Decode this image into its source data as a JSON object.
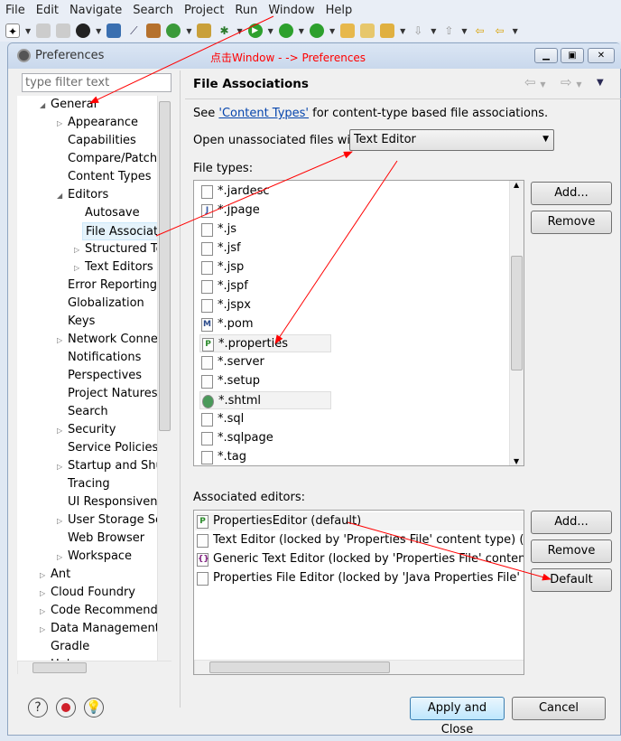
{
  "menubar": [
    "File",
    "Edit",
    "Navigate",
    "Search",
    "Project",
    "Run",
    "Window",
    "Help"
  ],
  "annotation": "点击Window - -> Preferences",
  "dialog": {
    "title": "Preferences",
    "filter_placeholder": "type filter text"
  },
  "tree": [
    {
      "label": "General",
      "level": 0,
      "expanded": true
    },
    {
      "label": "Appearance",
      "level": 1,
      "children": true
    },
    {
      "label": "Capabilities",
      "level": 1
    },
    {
      "label": "Compare/Patch",
      "level": 1
    },
    {
      "label": "Content Types",
      "level": 1
    },
    {
      "label": "Editors",
      "level": 1,
      "expanded": true
    },
    {
      "label": "Autosave",
      "level": 2
    },
    {
      "label": "File Associations",
      "level": 2,
      "selected": true
    },
    {
      "label": "Structured Text Editors",
      "level": 2,
      "children": true
    },
    {
      "label": "Text Editors",
      "level": 2,
      "children": true
    },
    {
      "label": "Error Reporting",
      "level": 1
    },
    {
      "label": "Globalization",
      "level": 1
    },
    {
      "label": "Keys",
      "level": 1
    },
    {
      "label": "Network Connections",
      "level": 1,
      "children": true
    },
    {
      "label": "Notifications",
      "level": 1
    },
    {
      "label": "Perspectives",
      "level": 1
    },
    {
      "label": "Project Natures",
      "level": 1
    },
    {
      "label": "Search",
      "level": 1
    },
    {
      "label": "Security",
      "level": 1,
      "children": true
    },
    {
      "label": "Service Policies",
      "level": 1
    },
    {
      "label": "Startup and Shutdown",
      "level": 1,
      "children": true
    },
    {
      "label": "Tracing",
      "level": 1
    },
    {
      "label": "UI Responsiveness",
      "level": 1
    },
    {
      "label": "User Storage Service",
      "level": 1,
      "children": true
    },
    {
      "label": "Web Browser",
      "level": 1
    },
    {
      "label": "Workspace",
      "level": 1,
      "children": true
    },
    {
      "label": "Ant",
      "level": 0,
      "children": true
    },
    {
      "label": "Cloud Foundry",
      "level": 0,
      "children": true
    },
    {
      "label": "Code Recommenders",
      "level": 0,
      "children": true
    },
    {
      "label": "Data Management",
      "level": 0,
      "children": true
    },
    {
      "label": "Gradle",
      "level": 0
    },
    {
      "label": "Help",
      "level": 0,
      "children": true
    }
  ],
  "page": {
    "title": "File Associations",
    "see_prefix": "See ",
    "see_link": "'Content Types'",
    "see_suffix": " for content-type based file associations.",
    "open_label": "Open unassociated files with:",
    "open_value": "Text Editor",
    "file_types_label": "File types:",
    "file_types": [
      {
        "name": "*.jardesc",
        "icon": "jar"
      },
      {
        "name": "*.jpage",
        "icon": "J"
      },
      {
        "name": "*.js",
        "icon": "doc"
      },
      {
        "name": "*.jsf",
        "icon": "doc"
      },
      {
        "name": "*.jsp",
        "icon": "doc"
      },
      {
        "name": "*.jspf",
        "icon": "doc"
      },
      {
        "name": "*.jspx",
        "icon": "doc"
      },
      {
        "name": "*.pom",
        "icon": "M"
      },
      {
        "name": "*.properties",
        "icon": "P",
        "highlight": true
      },
      {
        "name": "*.server",
        "icon": "srv"
      },
      {
        "name": "*.setup",
        "icon": "set"
      },
      {
        "name": "*.shtml",
        "icon": "globe",
        "highlight": true
      },
      {
        "name": "*.sql",
        "icon": "sql"
      },
      {
        "name": "*.sqlpage",
        "icon": "sql"
      },
      {
        "name": "*.tag",
        "icon": "doc"
      }
    ],
    "add_label": "Add...",
    "remove_label": "Remove",
    "editors_label": "Associated editors:",
    "editors": [
      {
        "name": "PropertiesEditor (default)",
        "icon": "P"
      },
      {
        "name": "Text Editor (locked by 'Properties File' content type) (locked by 'Java Properties File' content type)",
        "icon": "doc"
      },
      {
        "name": "Generic Text Editor (locked by 'Properties File' content type)",
        "icon": "{}"
      },
      {
        "name": "Properties File Editor (locked by 'Java Properties File' content type)",
        "icon": "doc"
      }
    ],
    "default_label": "Default"
  },
  "footer": {
    "apply_close": "Apply and Close",
    "cancel": "Cancel"
  },
  "colors": {
    "annotation": "#ff0000",
    "link": "#0645ad"
  }
}
